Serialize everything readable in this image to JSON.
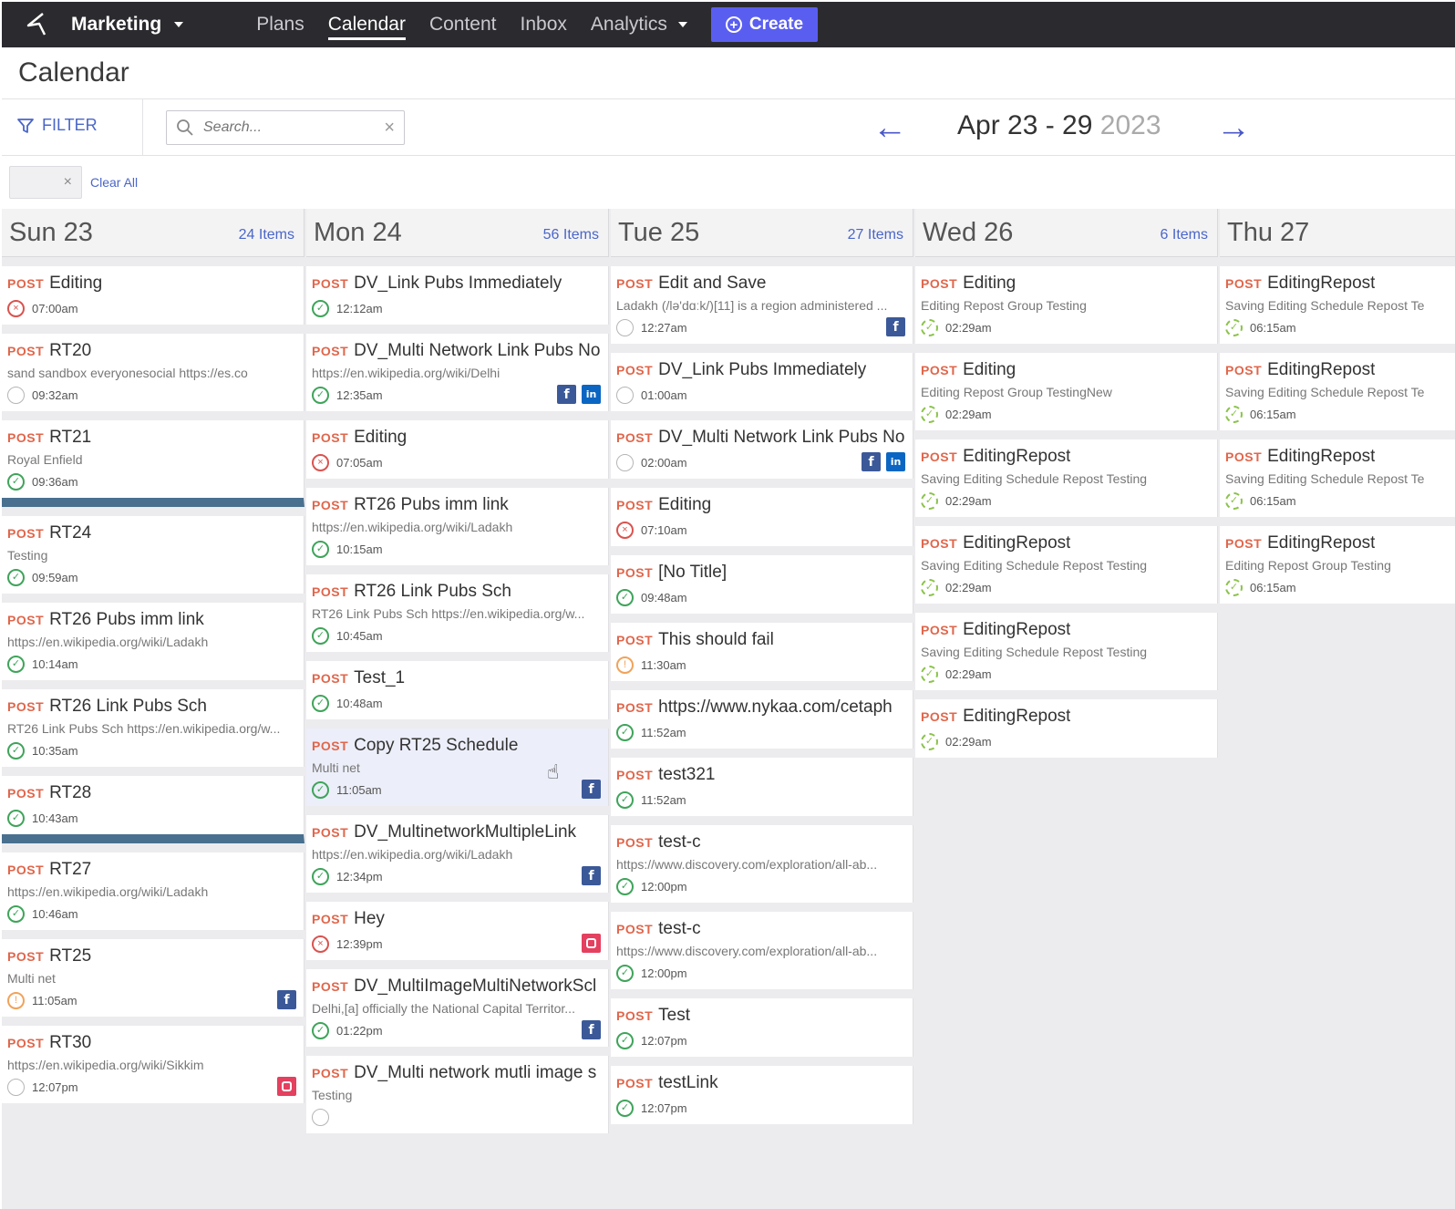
{
  "topbar": {
    "brand": "Marketing",
    "nav": [
      "Plans",
      "Calendar",
      "Content",
      "Inbox",
      "Analytics"
    ],
    "active": "Calendar",
    "create_label": "Create"
  },
  "page": {
    "title": "Calendar"
  },
  "toolbar": {
    "filter_label": "FILTER",
    "search_placeholder": "Search...",
    "date_range": "Apr 23 - 29",
    "year": "2023",
    "clear_all": "Clear All"
  },
  "colors": {
    "accent": "#5a5ef0",
    "post_tag": "#e0664b",
    "link": "#4a66c8",
    "divider_bar": "#49708f"
  },
  "columns": [
    {
      "day": "Sun 23",
      "count": "24 Items",
      "cards": [
        {
          "tag": "POST",
          "title": "Editing",
          "sub": "",
          "time": "07:00am",
          "status": "err",
          "social": []
        },
        {
          "tag": "POST",
          "title": "RT20",
          "sub": "sand sandbox everyonesocial https://es.co",
          "time": "09:32am",
          "status": "none",
          "social": []
        },
        {
          "tag": "POST",
          "title": "RT21",
          "sub": "Royal Enfield",
          "time": "09:36am",
          "status": "ok",
          "social": [],
          "bar": true
        },
        {
          "tag": "POST",
          "title": "RT24",
          "sub": "Testing",
          "time": "09:59am",
          "status": "ok",
          "social": []
        },
        {
          "tag": "POST",
          "title": "RT26 Pubs imm link",
          "sub": "https://en.wikipedia.org/wiki/Ladakh",
          "time": "10:14am",
          "status": "ok",
          "social": []
        },
        {
          "tag": "POST",
          "title": "RT26 Link Pubs Sch",
          "sub": "RT26 Link Pubs Sch https://en.wikipedia.org/w...",
          "time": "10:35am",
          "status": "ok",
          "social": []
        },
        {
          "tag": "POST",
          "title": "RT28",
          "sub": "",
          "time": "10:43am",
          "status": "ok",
          "social": [],
          "bar": true
        },
        {
          "tag": "POST",
          "title": "RT27",
          "sub": "https://en.wikipedia.org/wiki/Ladakh",
          "time": "10:46am",
          "status": "ok",
          "social": []
        },
        {
          "tag": "POST",
          "title": "RT25",
          "sub": "Multi net",
          "time": "11:05am",
          "status": "warn",
          "social": [
            "fb"
          ]
        },
        {
          "tag": "POST",
          "title": "RT30",
          "sub": "https://en.wikipedia.org/wiki/Sikkim",
          "time": "12:07pm",
          "status": "none",
          "social": [
            "ig"
          ]
        }
      ]
    },
    {
      "day": "Mon 24",
      "count": "56 Items",
      "cards": [
        {
          "tag": "POST",
          "title": "DV_Link Pubs Immediately",
          "sub": "",
          "time": "12:12am",
          "status": "ok",
          "social": []
        },
        {
          "tag": "POST",
          "title": "DV_Multi Network Link Pubs No",
          "sub": "https://en.wikipedia.org/wiki/Delhi",
          "time": "12:35am",
          "status": "ok",
          "social": [
            "fb",
            "li"
          ]
        },
        {
          "tag": "POST",
          "title": "Editing",
          "sub": "",
          "time": "07:05am",
          "status": "err",
          "social": []
        },
        {
          "tag": "POST",
          "title": "RT26 Pubs imm link",
          "sub": "https://en.wikipedia.org/wiki/Ladakh",
          "time": "10:15am",
          "status": "ok",
          "social": []
        },
        {
          "tag": "POST",
          "title": "RT26 Link Pubs Sch",
          "sub": "RT26 Link Pubs Sch https://en.wikipedia.org/w...",
          "time": "10:45am",
          "status": "ok",
          "social": []
        },
        {
          "tag": "POST",
          "title": "Test_1",
          "sub": "",
          "time": "10:48am",
          "status": "ok",
          "social": []
        },
        {
          "tag": "POST",
          "title": "Copy RT25 Schedule",
          "sub": "Multi net",
          "time": "11:05am",
          "status": "ok",
          "social": [
            "fb"
          ],
          "hl": true
        },
        {
          "tag": "POST",
          "title": "DV_MultinetworkMultipleLink",
          "sub": "https://en.wikipedia.org/wiki/Ladakh",
          "time": "12:34pm",
          "status": "ok",
          "social": [
            "fb"
          ]
        },
        {
          "tag": "POST",
          "title": "Hey",
          "sub": "",
          "time": "12:39pm",
          "status": "err",
          "social": [
            "ig"
          ]
        },
        {
          "tag": "POST",
          "title": "DV_MultiImageMultiNetworkScl",
          "sub": "Delhi,[a] officially the National Capital Territor...",
          "time": "01:22pm",
          "status": "ok",
          "social": [
            "fb"
          ]
        },
        {
          "tag": "POST",
          "title": "DV_Multi network mutli image s",
          "sub": "Testing",
          "time": "",
          "status": "none",
          "social": []
        }
      ]
    },
    {
      "day": "Tue 25",
      "count": "27 Items",
      "cards": [
        {
          "tag": "POST",
          "title": "Edit and Save",
          "sub": "Ladakh (/lə'dɑːk/)[11] is a region administered ...",
          "time": "12:27am",
          "status": "none",
          "social": [
            "fb"
          ]
        },
        {
          "tag": "POST",
          "title": "DV_Link Pubs Immediately",
          "sub": "",
          "time": "01:00am",
          "status": "none",
          "social": []
        },
        {
          "tag": "POST",
          "title": "DV_Multi Network Link Pubs No",
          "sub": "",
          "time": "02:00am",
          "status": "none",
          "social": [
            "fb",
            "li"
          ]
        },
        {
          "tag": "POST",
          "title": "Editing",
          "sub": "",
          "time": "07:10am",
          "status": "err",
          "social": []
        },
        {
          "tag": "POST",
          "title": "[No Title]",
          "sub": "",
          "time": "09:48am",
          "status": "ok",
          "social": []
        },
        {
          "tag": "POST",
          "title": "This should fail",
          "sub": "",
          "time": "11:30am",
          "status": "warn",
          "social": []
        },
        {
          "tag": "POST",
          "title": "https://www.nykaa.com/cetaph",
          "sub": "",
          "time": "11:52am",
          "status": "ok",
          "social": []
        },
        {
          "tag": "POST",
          "title": "test321",
          "sub": "",
          "time": "11:52am",
          "status": "ok",
          "social": []
        },
        {
          "tag": "POST",
          "title": "test-c",
          "sub": "https://www.discovery.com/exploration/all-ab...",
          "time": "12:00pm",
          "status": "ok",
          "social": []
        },
        {
          "tag": "POST",
          "title": "test-c",
          "sub": "https://www.discovery.com/exploration/all-ab...",
          "time": "12:00pm",
          "status": "ok",
          "social": []
        },
        {
          "tag": "POST",
          "title": "Test",
          "sub": "",
          "time": "12:07pm",
          "status": "ok",
          "social": []
        },
        {
          "tag": "POST",
          "title": "testLink",
          "sub": "",
          "time": "12:07pm",
          "status": "ok",
          "social": []
        }
      ]
    },
    {
      "day": "Wed 26",
      "count": "6 Items",
      "cards": [
        {
          "tag": "POST",
          "title": "Editing",
          "sub": "Editing Repost Group Testing",
          "time": "02:29am",
          "status": "pend",
          "social": []
        },
        {
          "tag": "POST",
          "title": "Editing",
          "sub": "Editing Repost Group TestingNew",
          "time": "02:29am",
          "status": "pend",
          "social": []
        },
        {
          "tag": "POST",
          "title": "EditingRepost",
          "sub": "Saving Editing Schedule Repost Testing",
          "time": "02:29am",
          "status": "pend",
          "social": []
        },
        {
          "tag": "POST",
          "title": "EditingRepost",
          "sub": "Saving Editing Schedule Repost Testing",
          "time": "02:29am",
          "status": "pend",
          "social": []
        },
        {
          "tag": "POST",
          "title": "EditingRepost",
          "sub": "Saving Editing Schedule Repost Testing",
          "time": "02:29am",
          "status": "pend",
          "social": []
        },
        {
          "tag": "POST",
          "title": "EditingRepost",
          "sub": "",
          "time": "02:29am",
          "status": "pend",
          "social": []
        }
      ]
    },
    {
      "day": "Thu 27",
      "count": "",
      "cards": [
        {
          "tag": "POST",
          "title": "EditingRepost",
          "sub": "Saving Editing Schedule Repost Te",
          "time": "06:15am",
          "status": "pend",
          "social": []
        },
        {
          "tag": "POST",
          "title": "EditingRepost",
          "sub": "Saving Editing Schedule Repost Te",
          "time": "06:15am",
          "status": "pend",
          "social": []
        },
        {
          "tag": "POST",
          "title": "EditingRepost",
          "sub": "Saving Editing Schedule Repost Te",
          "time": "06:15am",
          "status": "pend",
          "social": []
        },
        {
          "tag": "POST",
          "title": "EditingRepost",
          "sub": "Editing Repost Group Testing",
          "time": "06:15am",
          "status": "pend",
          "social": []
        }
      ]
    }
  ]
}
